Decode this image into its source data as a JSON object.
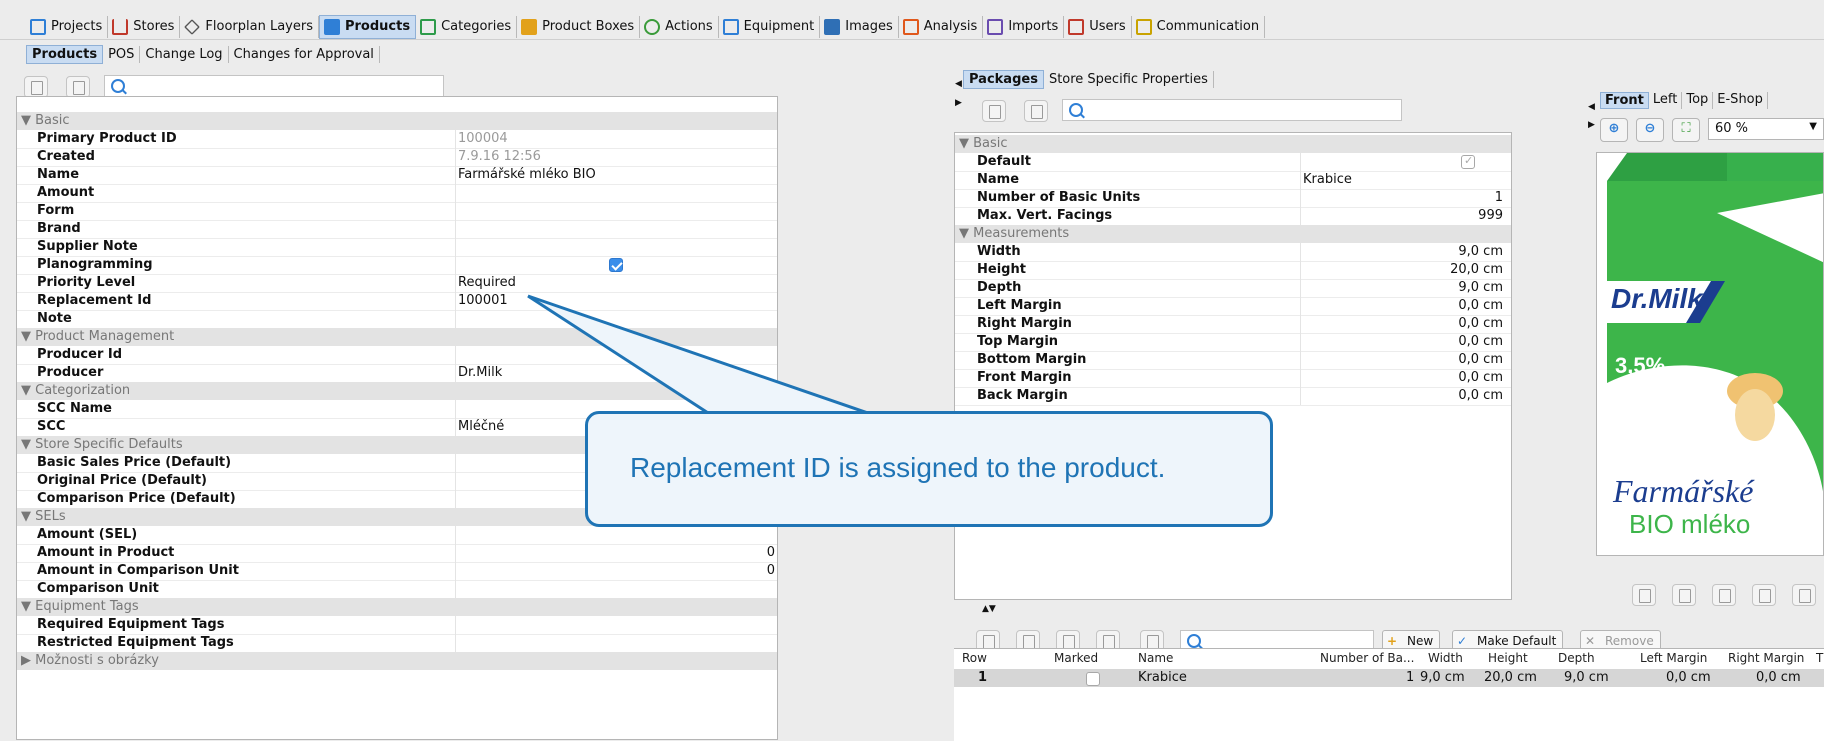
{
  "topmenu": [
    {
      "label": "Projects",
      "icon": "projects-icon",
      "color": "#2f7fd6"
    },
    {
      "label": "Stores",
      "icon": "stores-icon",
      "color": "#c0392b"
    },
    {
      "label": "Floorplan Layers",
      "icon": "layers-icon",
      "color": "#555555"
    },
    {
      "label": "Products",
      "icon": "products-icon",
      "color": "#2f7fd6",
      "active": true
    },
    {
      "label": "Categories",
      "icon": "categories-icon",
      "color": "#2e9b4a"
    },
    {
      "label": "Product Boxes",
      "icon": "product-boxes-icon",
      "color": "#e2a11a"
    },
    {
      "label": "Actions",
      "icon": "actions-icon",
      "color": "#3a9b3a"
    },
    {
      "label": "Equipment",
      "icon": "equipment-icon",
      "color": "#2f7fd6"
    },
    {
      "label": "Images",
      "icon": "images-icon",
      "color": "#2f6fb5"
    },
    {
      "label": "Analysis",
      "icon": "analysis-icon",
      "color": "#e0581c"
    },
    {
      "label": "Imports",
      "icon": "imports-icon",
      "color": "#6a4caf"
    },
    {
      "label": "Users",
      "icon": "users-icon",
      "color": "#c0392b"
    },
    {
      "label": "Communication",
      "icon": "communication-icon",
      "color": "#c9a300"
    }
  ],
  "subtabs": [
    "Products",
    "POS",
    "Change Log",
    "Changes for Approval"
  ],
  "left_sections": {
    "basic": "Basic",
    "product_management": "Product Management",
    "categorization": "Categorization",
    "store_defaults": "Store Specific Defaults",
    "sels": "SELs",
    "equipment_tags": "Equipment Tags",
    "image_options": "Možnosti s obrázky"
  },
  "left_rows": {
    "primary_id": {
      "label": "Primary Product ID",
      "value": "100004"
    },
    "created": {
      "label": "Created",
      "value": "7.9.16 12:56"
    },
    "name": {
      "label": "Name",
      "value": "Farmářské mléko BIO"
    },
    "amount": {
      "label": "Amount",
      "value": ""
    },
    "form": {
      "label": "Form",
      "value": ""
    },
    "brand": {
      "label": "Brand",
      "value": ""
    },
    "supplier_note": {
      "label": "Supplier Note",
      "value": ""
    },
    "planogramming": {
      "label": "Planogramming",
      "checked": true
    },
    "priority": {
      "label": "Priority Level",
      "value": "Required"
    },
    "replacement": {
      "label": "Replacement Id",
      "value": "100001"
    },
    "note": {
      "label": "Note",
      "value": ""
    },
    "producer_id": {
      "label": "Producer Id",
      "value": ""
    },
    "producer": {
      "label": "Producer",
      "value": "Dr.Milk"
    },
    "scc_name": {
      "label": "SCC Name",
      "value": ""
    },
    "scc": {
      "label": "SCC",
      "value": "Mléčné"
    },
    "basic_price": {
      "label": "Basic Sales Price (Default)",
      "value": ""
    },
    "orig_price": {
      "label": "Original Price (Default)",
      "value": ""
    },
    "comp_price": {
      "label": "Comparison Price (Default)",
      "value": ""
    },
    "amount_sel": {
      "label": "Amount (SEL)",
      "value": ""
    },
    "amount_product": {
      "label": "Amount in Product",
      "value": "0"
    },
    "amount_comp_unit": {
      "label": "Amount in Comparison Unit",
      "value": "0"
    },
    "comp_unit": {
      "label": "Comparison Unit",
      "value": ""
    },
    "req_tags": {
      "label": "Required Equipment Tags",
      "value": ""
    },
    "restr_tags": {
      "label": "Restricted Equipment Tags",
      "value": ""
    }
  },
  "pkg_tabs": [
    "Packages",
    "Store Specific Properties"
  ],
  "pkg_sections": {
    "basic": "Basic",
    "measurements": "Measurements"
  },
  "pkg_rows": {
    "default": {
      "label": "Default",
      "checked": true
    },
    "name": {
      "label": "Name",
      "value": "Krabice"
    },
    "basic_units": {
      "label": "Number of Basic Units",
      "value": "1"
    },
    "max_facings": {
      "label": "Max. Vert. Facings",
      "value": "999"
    },
    "width": {
      "label": "Width",
      "value": "9,0 cm"
    },
    "height": {
      "label": "Height",
      "value": "20,0 cm"
    },
    "depth": {
      "label": "Depth",
      "value": "9,0 cm"
    },
    "left_margin": {
      "label": "Left Margin",
      "value": "0,0 cm"
    },
    "right_margin": {
      "label": "Right Margin",
      "value": "0,0 cm"
    },
    "top_margin": {
      "label": "Top Margin",
      "value": "0,0 cm"
    },
    "bottom_margin": {
      "label": "Bottom Margin",
      "value": "0,0 cm"
    },
    "front_margin": {
      "label": "Front Margin",
      "value": "0,0 cm"
    },
    "back_margin": {
      "label": "Back Margin",
      "value": "0,0 cm"
    }
  },
  "view_tabs": [
    "Front",
    "Left",
    "Top",
    "E-Shop"
  ],
  "zoom": "60 %",
  "product_image": {
    "brand": "Dr.Milk",
    "fat": "3,5%",
    "line1": "Farmářské",
    "line2": "BIO mléko"
  },
  "bottom_buttons": {
    "new": "New",
    "make_default": "Make Default",
    "remove": "Remove"
  },
  "table": {
    "headers": [
      "Row",
      "Marked",
      "Name",
      "Number of Ba...",
      "Width",
      "Height",
      "Depth",
      "Left Margin",
      "Right Margin",
      "T"
    ],
    "row": {
      "row": "1",
      "marked": false,
      "name": "Krabice",
      "units": "1",
      "width": "9,0 cm",
      "height": "20,0 cm",
      "depth": "9,0 cm",
      "left": "0,0 cm",
      "right": "0,0 cm"
    }
  },
  "callout": {
    "text": "Replacement ID is assigned to the product."
  },
  "colors": {
    "accent": "#1f74b5",
    "selection": "#c9dcf2",
    "milk_green": "#3db54a"
  }
}
